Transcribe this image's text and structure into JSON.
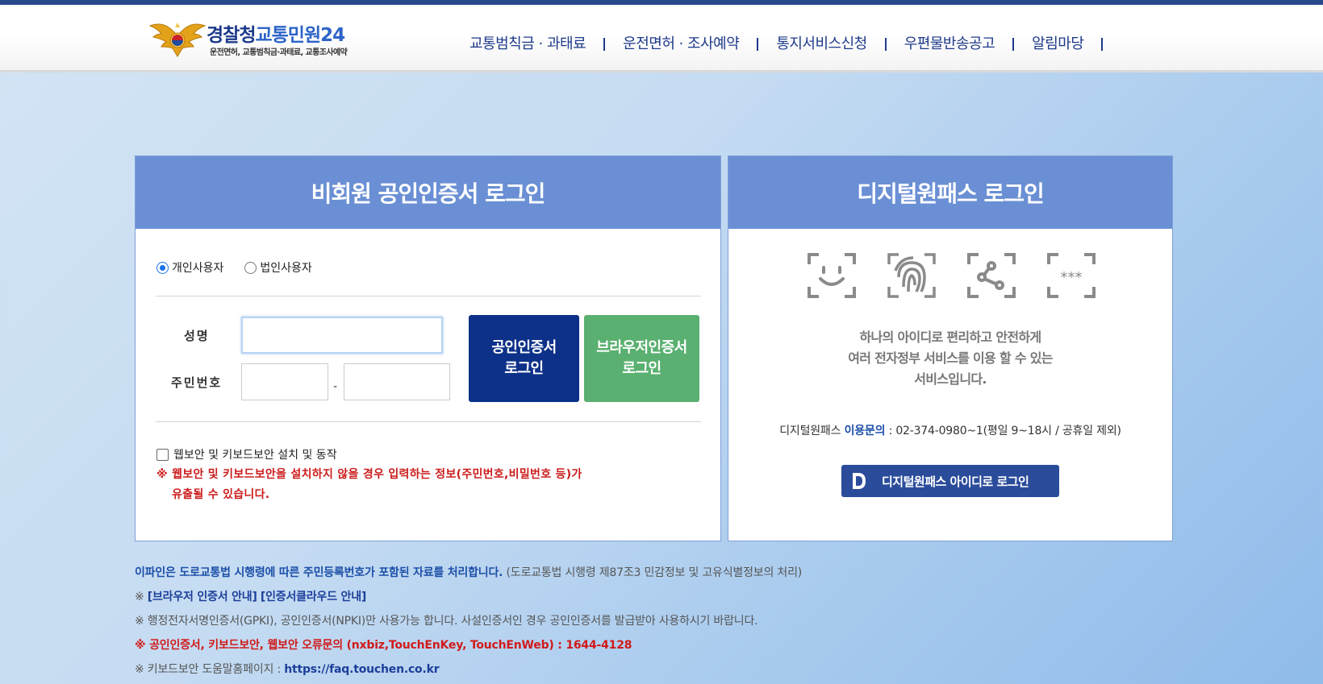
{
  "header": {
    "logo_title_prefix": "경찰청",
    "logo_title_suffix": "교통민원24",
    "logo_subtitle": "운전면허, 교통범칙금·과태료, 교통조사예약",
    "nav": [
      {
        "label": "교통범칙금 · 과태료"
      },
      {
        "label": "운전면허 · 조사예약"
      },
      {
        "label": "통지서비스신청"
      },
      {
        "label": "우편물반송공고"
      },
      {
        "label": "알림마당"
      }
    ]
  },
  "left_panel": {
    "title": "비회원 공인인증서 로그인",
    "radio_individual": "개인사용자",
    "radio_corporate": "법인사용자",
    "name_label": "성명",
    "name_value": "",
    "rrn_label": "주민번호",
    "rrn_first": "",
    "rrn_second": "",
    "rrn_separator": "-",
    "btn_public_cert": "공인인증서\n로그인",
    "btn_browser_cert": "브라우저인증서\n로그인",
    "security_checkbox": "웹보안 및 키보드보안 설치 및 동작",
    "warning_line1": "※ 웹보안 및 키보드보안을 설치하지 않을 경우 입력하는 정보(주민번호,비밀번호 등)가",
    "warning_line2": "유출될 수 있습니다."
  },
  "right_panel": {
    "title": "디지털원패스 로그인",
    "icons": [
      "face-recognition-icon",
      "fingerprint-icon",
      "pattern-icon",
      "password-icon"
    ],
    "desc_line1": "하나의 아이디로 편리하고 안전하게",
    "desc_line2": "여러 전자정부 서비스를 이용 할 수 있는",
    "desc_line3": "서비스입니다.",
    "inquiry_prefix": "디지털원패스",
    "inquiry_label": "이용문의",
    "inquiry_text": ": 02-374-0980~1(평일 9~18시 / 공휴일 제외)",
    "onepass_button": "디지털원패스 아이디로 로그인"
  },
  "notes": {
    "line1_bold": "이파인은 도로교통법 시행령에 따른 주민등록번호가 포함된 자료를 처리합니다.",
    "line1_rest": "(도로교통법 시행령 제87조3 민감정보 및 고유식별정보의 처리)",
    "line2_prefix": "※ ",
    "line2_link1": "[브라우저 인증서 안내]",
    "line2_link2": "[인증서클라우드 안내]",
    "line3": "※ 행정전자서명인증서(GPKI), 공인인증서(NPKI)만 사용가능 합니다. 사설인증서인 경우 공인인증서를 발급받아 사용하시기 바랍니다.",
    "line4": "※ 공인인증서, 키보드보안, 웹보안 오류문의 (nxbiz,TouchEnKey, TouchEnWeb) : 1644-4128",
    "line5_prefix": "※ 키보드보안 도움말홈페이지 : ",
    "line5_link": "https://faq.touchen.co.kr"
  },
  "colors": {
    "header_bar": "#2a4a8e",
    "panel_head": "#6a8fd4",
    "btn_public": "#0d3188",
    "btn_browser": "#5ab070",
    "warning": "#cc1c1c"
  }
}
